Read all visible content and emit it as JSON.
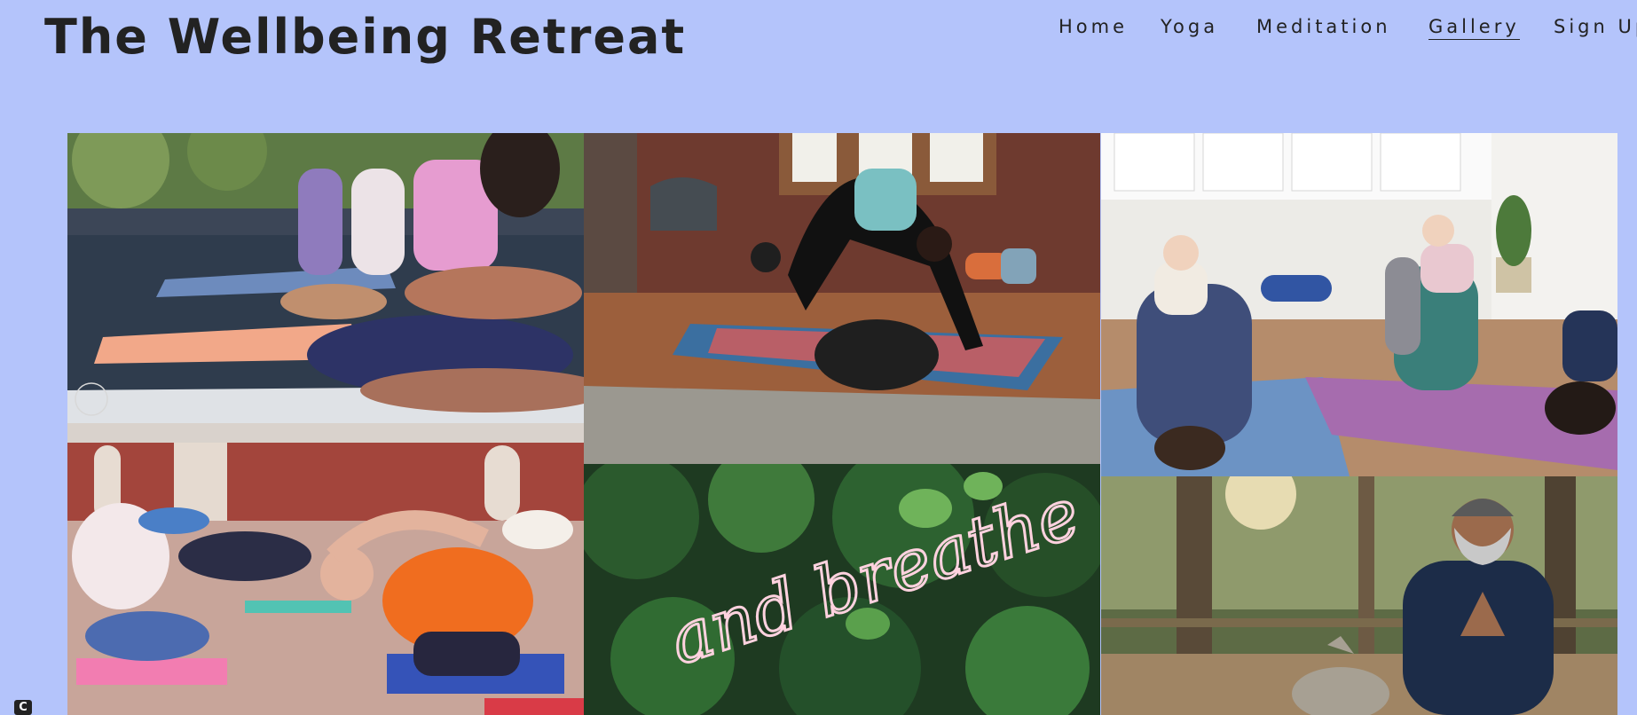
{
  "header": {
    "site_title": "The Wellbeing Retreat"
  },
  "nav": {
    "items": [
      {
        "label": "Home"
      },
      {
        "label": "Yoga"
      },
      {
        "label": "Meditation"
      },
      {
        "label": "Gallery",
        "active": true
      },
      {
        "label": "Sign Up"
      }
    ]
  },
  "gallery": {
    "photos": [
      {
        "subject": "outdoor group meditation on yoga mats"
      },
      {
        "subject": "woman in downward dog with a black dog"
      },
      {
        "subject": "mothers doing yoga with babies"
      },
      {
        "subject": "indoor group yoga side stretch"
      },
      {
        "subject": "neon sign and breathe on leafy wall",
        "sign_text": "and breathe"
      },
      {
        "subject": "man meditating outdoors with a cat"
      }
    ]
  },
  "corner_badge": {
    "label": "C"
  },
  "colors": {
    "page_background": "#b4c4fb",
    "text": "#222222"
  }
}
